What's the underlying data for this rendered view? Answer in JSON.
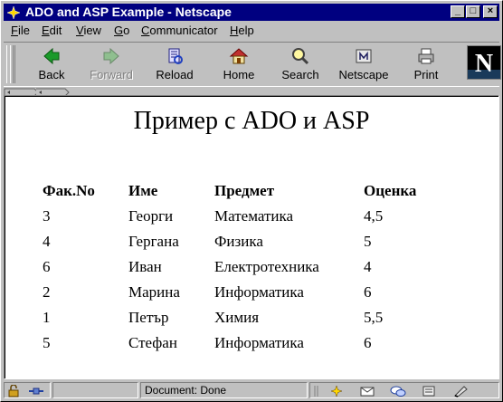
{
  "window": {
    "title": "ADO and ASP Example - Netscape"
  },
  "title_buttons": [
    "_",
    "□",
    "×"
  ],
  "menu": [
    {
      "pre": "",
      "u": "F",
      "post": "ile"
    },
    {
      "pre": "",
      "u": "E",
      "post": "dit"
    },
    {
      "pre": "",
      "u": "V",
      "post": "iew"
    },
    {
      "pre": "",
      "u": "G",
      "post": "o"
    },
    {
      "pre": "",
      "u": "C",
      "post": "ommunicator"
    },
    {
      "pre": "",
      "u": "H",
      "post": "elp"
    }
  ],
  "toolbar": {
    "back": "Back",
    "forward": "Forward",
    "reload": "Reload",
    "home": "Home",
    "search": "Search",
    "netscape": "Netscape",
    "print": "Print",
    "logo_letter": "N"
  },
  "page": {
    "heading": "Пример с ADO и ASP",
    "table": {
      "headers": [
        "Фак.No",
        "Име",
        "Предмет",
        "Оценка"
      ],
      "rows": [
        [
          "3",
          "Георги",
          "Математика",
          "4,5"
        ],
        [
          "4",
          "Гергана",
          "Физика",
          "5"
        ],
        [
          "6",
          "Иван",
          "Електротехника",
          "4"
        ],
        [
          "2",
          "Марина",
          "Информатика",
          "6"
        ],
        [
          "1",
          "Петър",
          "Химия",
          "5,5"
        ],
        [
          "5",
          "Стефан",
          "Информатика",
          "6"
        ]
      ]
    }
  },
  "status": {
    "text": "Document: Done"
  },
  "colors": {
    "titlebar": "#000080",
    "chrome": "#c0c0c0",
    "page": "#ffffff"
  }
}
